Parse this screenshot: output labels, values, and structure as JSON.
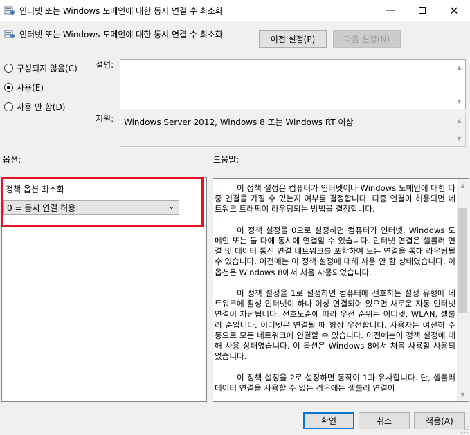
{
  "window": {
    "title": "인터넷 또는 Windows 도메인에 대한 동시 연결 수 최소화",
    "minimize_icon": "minimize-icon",
    "maximize_icon": "maximize-icon",
    "close_icon": "close-icon"
  },
  "header": {
    "title": "인터넷 또는 Windows 도메인에 대한 동시 연결 수 최소화",
    "prev_button": "이전 설정(P)",
    "next_button": "다음 설정(N)"
  },
  "state": {
    "options": [
      {
        "label": "구성되지 않음(C)",
        "checked": false
      },
      {
        "label": "사용(E)",
        "checked": true
      },
      {
        "label": "사용 안 함(D)",
        "checked": false
      }
    ]
  },
  "comment": {
    "label": "설명:",
    "value": ""
  },
  "supported": {
    "label": "지원:",
    "value": "Windows Server 2012, Windows 8 또는 Windows RT 이상"
  },
  "options_section": {
    "label": "옵션:",
    "policy_label": "정책 옵션 최소화",
    "selected_value": "0 = 동시 연결 허용"
  },
  "help_section": {
    "label": "도움말:",
    "paragraphs": [
      "이 정책 설정은 컴퓨터가 인터넷이나 Windows 도메인에 대한 다중 연결을 가질 수 있는지 여부를 결정합니다. 다중 연결이 허용되면 네트워크 트래픽이 라우팅되는 방법을 결정합니다.",
      "이 정책 설정을 0으로 설정하면 컴퓨터가 인터넷, Windows 도메인 또는 둘 다에 동시에 연결할 수 있습니다. 인터넷 연결은 셀룰러 연결 및 데이터 통신 연결 네트워크를 포함하여 모든 연결을 통해 라우팅될 수 있습니다. 이전에는 이 정책 설정에 대해 사용 안 함 상태였습니다. 이 옵션은 Windows 8에서 처음 사용되었습니다.",
      "이 정책 설정을 1로 설정하면 컴퓨터에 선호하는 설정 유형에 네트워크에 활성 인터넷이 하나 이상 연결되어 있으면 새로운 자동 인터넷 연결이 차단됩니다. 선호도순에 따라 우선 순위는 이더넷, WLAN, 셀룰러 순입니다. 이더넷은 연결될 때 항상 우선합니다. 사용자는 여전히 수동으로 모든 네트워크에 연결할 수 있습니다. 이전에는이 정책 설정에 대해 사용 상태였습니다. 이 옵션은 Windows 8에서 처음 사용할 사용되었습니다.",
      "이 정책 설정을 2로 설정하면 동작이 1과 유사합니다. 단, 셀룰러 데이터 연결을 사용할 수 있는 경우에는 셀룰러 연결이"
    ]
  },
  "footer": {
    "ok_button": "확인",
    "cancel_button": "취소",
    "apply_button": "적용(A)"
  },
  "colors": {
    "highlight_frame": "#e81123",
    "default_button_border": "#0078d7"
  }
}
